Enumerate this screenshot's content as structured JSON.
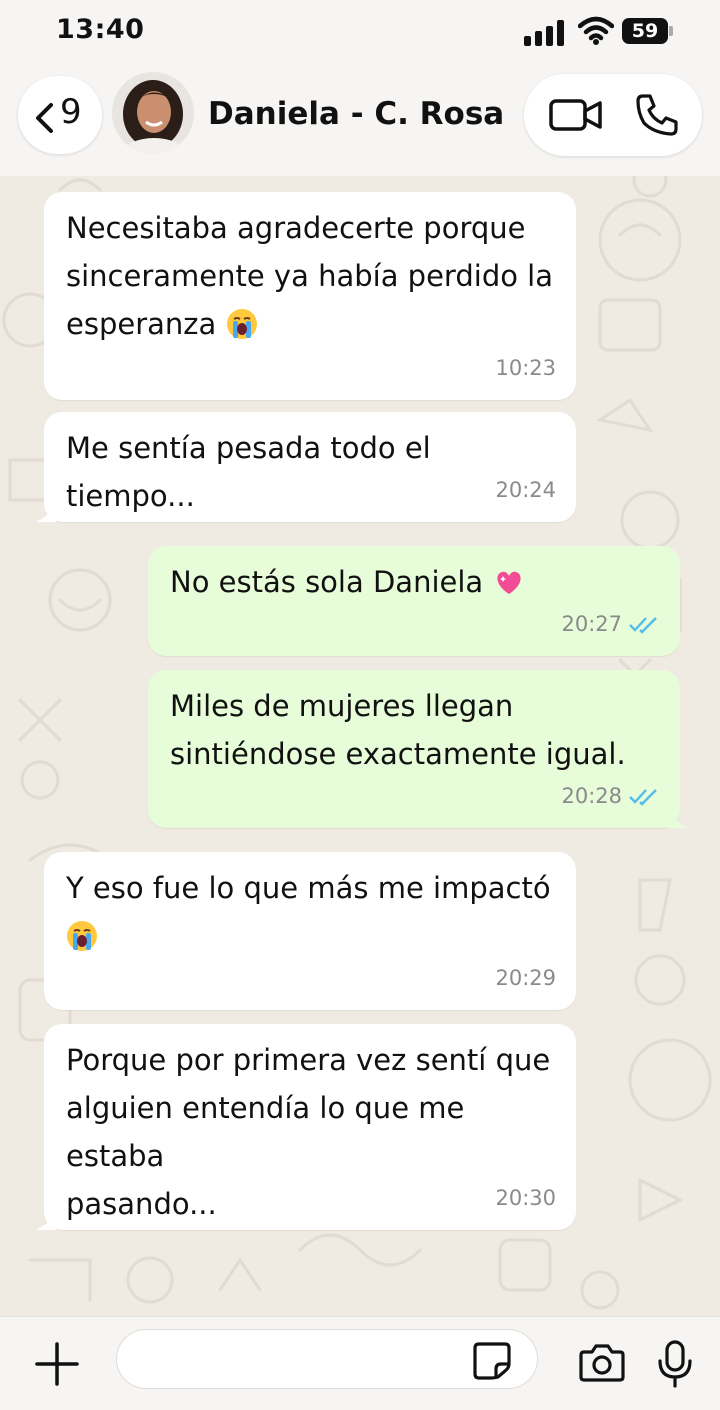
{
  "status": {
    "time": "13:40",
    "battery": "59"
  },
  "header": {
    "back_count": "9",
    "contact_name": "Daniela - C. Rosa"
  },
  "icons": {
    "back": "chevron-left-icon",
    "video": "video-camera-icon",
    "phone": "phone-icon",
    "plus": "plus-icon",
    "sticker": "sticker-icon",
    "camera": "camera-icon",
    "mic": "microphone-icon"
  },
  "colors": {
    "incoming_bubble": "#ffffff",
    "outgoing_bubble": "#e7fcd8",
    "read_ticks": "#53bdeb",
    "background": "#efeae2"
  },
  "messages": [
    {
      "direction": "in",
      "lines": [
        "Necesitaba agradecerte porque",
        "sinceramente ya había perdido la",
        "esperanza"
      ],
      "emoji": "loudly-crying-face",
      "time": "10:23"
    },
    {
      "direction": "in",
      "lines": [
        "Me sentía pesada todo el tiempo..."
      ],
      "time": "20:24"
    },
    {
      "direction": "out",
      "lines": [
        "No estás sola Daniela"
      ],
      "emoji": "sparkling-heart",
      "time": "20:27",
      "status": "read"
    },
    {
      "direction": "out",
      "lines": [
        "Miles de mujeres llegan",
        "sintiéndose exactamente igual."
      ],
      "time": "20:28",
      "status": "read"
    },
    {
      "direction": "in",
      "lines": [
        "Y eso fue lo que más me impactó"
      ],
      "emoji": "loudly-crying-face",
      "time": "20:29"
    },
    {
      "direction": "in",
      "lines": [
        "Porque por primera vez sentí que",
        "alguien entendía lo que me estaba",
        "pasando..."
      ],
      "time": "20:30"
    }
  ]
}
